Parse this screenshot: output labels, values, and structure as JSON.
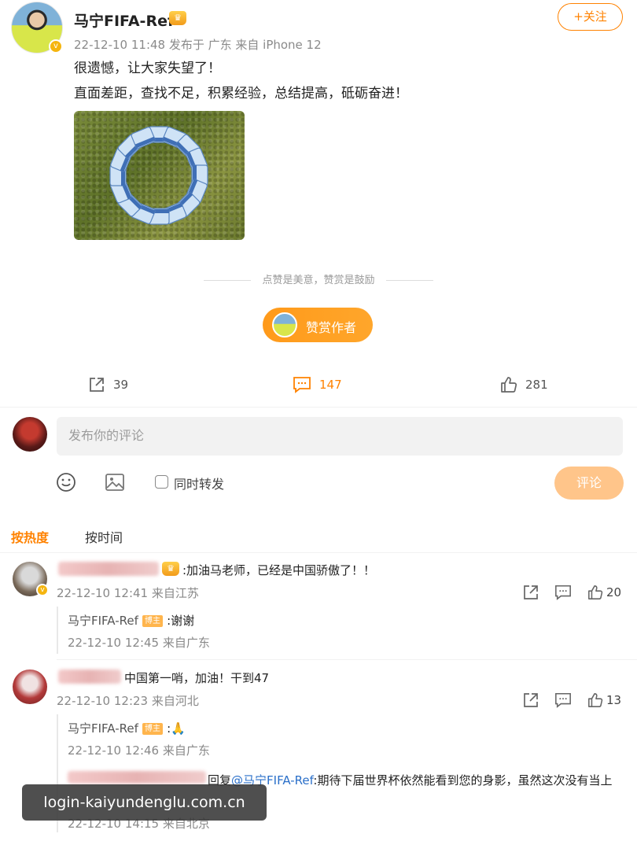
{
  "post": {
    "username": "马宁FIFA-Ref",
    "follow_label": "+关注",
    "meta": "22-12-10 11:48  发布于 广东  来自 iPhone 12",
    "line1": "很遗憾，让大家失望了！",
    "line2": "直面差距，查找不足，积累经验，总结提高，砥砺奋进！",
    "image_icon": "fifa-armbands-circle-photo"
  },
  "reward": {
    "hint": "点赞是美意，赞赏是鼓励",
    "button_label": "赞赏作者"
  },
  "actions": {
    "share_count": "39",
    "comment_count": "147",
    "like_count": "281"
  },
  "composer": {
    "placeholder": "发布你的评论",
    "repost_label": "同时转发",
    "submit_label": "评论"
  },
  "sort": {
    "hot": "按热度",
    "time": "按时间"
  },
  "comments": [
    {
      "text": ":加油马老师，已经是中国骄傲了！！",
      "meta": "22-12-10 12:41 来自江苏",
      "likes": "20",
      "reply": {
        "user": "马宁FIFA-Ref",
        "tag": "博主",
        "text": ":谢谢",
        "meta": "22-12-10 12:45 来自广东"
      }
    },
    {
      "text": "中国第一哨，加油！干到47",
      "meta": "22-12-10 12:23 来自河北",
      "likes": "13",
      "reply": {
        "user": "马宁FIFA-Ref",
        "tag": "博主",
        "text": ":🙏",
        "meta": "22-12-10 12:46 来自广东"
      },
      "nested_reply": {
        "prefix": "回复",
        "mention": "@马宁FIFA-Ref",
        "text": ":期待下届世界杯依然能看到您的身影，虽然这次没有当上",
        "meta": "22-12-10 14:15 来自北京"
      }
    }
  ],
  "watermark": "login-kaiyundenglu.com.cn",
  "colors": {
    "accent": "#ff8200",
    "reward_orange": "#ff9a1a",
    "submit_disabled": "#ffc58a",
    "mention_blue": "#2a6fc9"
  }
}
